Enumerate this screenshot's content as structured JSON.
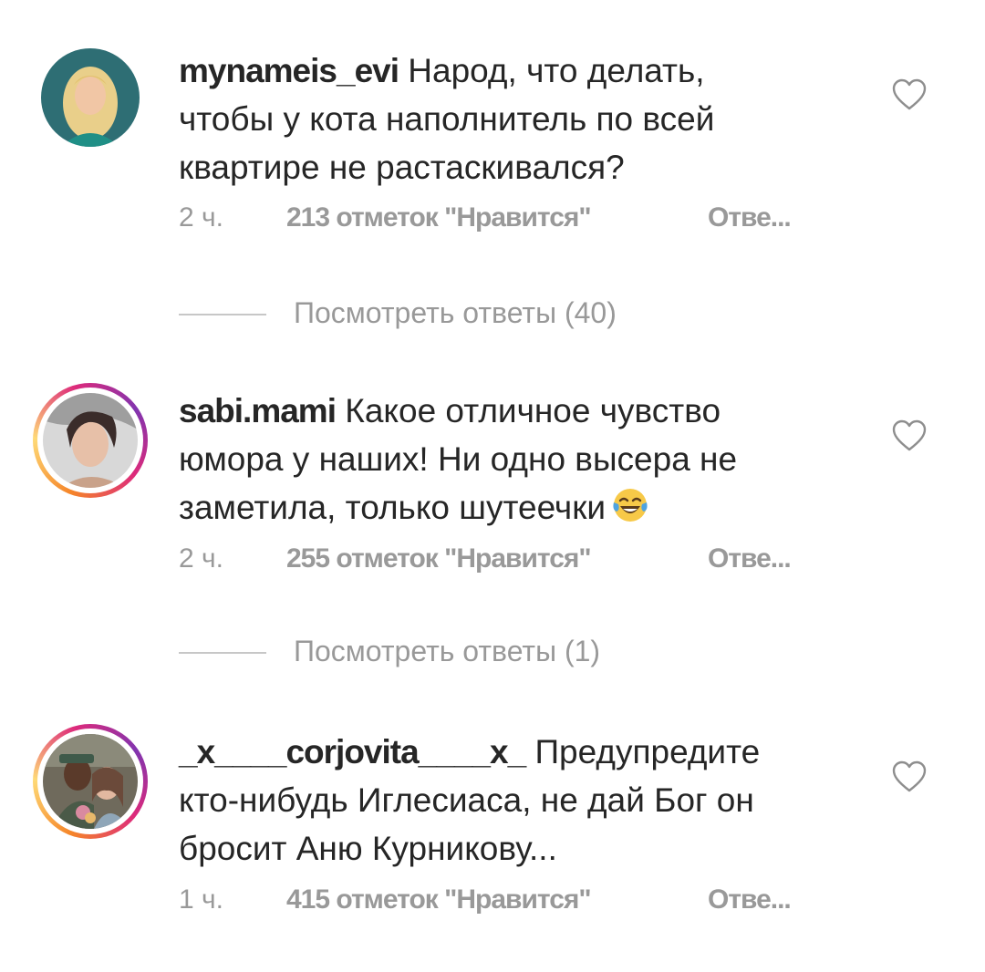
{
  "comments": [
    {
      "username": "mynameis_evi",
      "text_lines": [
        "Народ, что делать,",
        "чтобы у кота наполнитель по всей",
        "квартире не растаскивался?"
      ],
      "time": "2 ч.",
      "likes": "213 отметок \"Нравится\"",
      "reply": "Отве...",
      "avatar_ring": false,
      "avatar_icon": "woman-portrait-avatar"
    },
    {
      "username": "sabi.mami",
      "text_lines": [
        "Какое отличное чувство",
        "юмора у наших! Ни одно высера не",
        "заметила, только шутеечки"
      ],
      "time": "2 ч.",
      "likes": "255 отметок \"Нравится\"",
      "reply": "Отве...",
      "avatar_ring": true,
      "avatar_icon": "woman-portrait-avatar",
      "emoji": "laughing-tears-emoji"
    },
    {
      "username": "_x____corjovita____x_",
      "text_lines": [
        "Предупредите",
        "кто-нибудь Иглесиаса, не дай Бог он",
        "бросит Аню Курникову..."
      ],
      "time": "1 ч.",
      "likes": "415 отметок \"Нравится\"",
      "reply": "Отве...",
      "avatar_ring": true,
      "avatar_icon": "couple-photo-avatar"
    }
  ],
  "view_replies": [
    {
      "label": "Посмотреть ответы (40)"
    },
    {
      "label": "Посмотреть ответы (1)"
    }
  ],
  "colors": {
    "text": "#262626",
    "meta": "#999999",
    "divider": "#c7c7c7",
    "heart": "#8e8e8e"
  }
}
